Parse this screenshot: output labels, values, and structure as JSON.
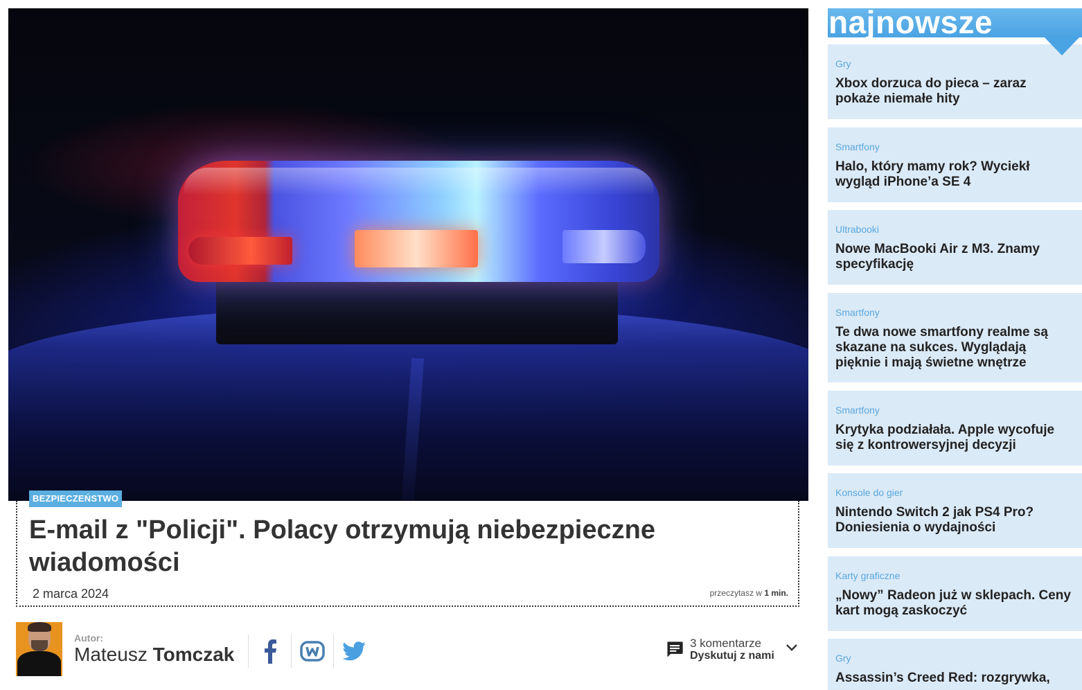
{
  "article": {
    "category": "BEZPIECZEŃSTWO",
    "title": "E-mail z \"Policji\". Polacy otrzymują niebezpieczne wiadomości",
    "date": "2 marca 2024",
    "read_time_prefix": "przeczytasz w",
    "read_time_value": "1 min.",
    "hero_image": "police-light-bar-photo"
  },
  "author": {
    "label": "Autor:",
    "first_name": "Mateusz",
    "last_name": "Tomczak"
  },
  "social": {
    "icons": [
      "facebook-icon",
      "wykop-icon",
      "twitter-icon"
    ]
  },
  "comments": {
    "count_text": "3 komentarze",
    "cta": "Dyskutuj z nami"
  },
  "sidebar": {
    "title": "najnowsze",
    "accent_color": "#4aa3e2",
    "card_color": "#dbeaf7",
    "items": [
      {
        "category": "Gry",
        "title": "Xbox dorzuca do pieca – zaraz pokaże niemałe hity"
      },
      {
        "category": "Smartfony",
        "title": "Halo, który mamy rok? Wyciekł wygląd iPhone’a SE 4"
      },
      {
        "category": "Ultrabooki",
        "title": "Nowe MacBooki Air z M3. Znamy specyfikację"
      },
      {
        "category": "Smartfony",
        "title": "Te dwa nowe smartfony realme są skazane na sukces. Wyglądają pięknie i mają świetne wnętrze"
      },
      {
        "category": "Smartfony",
        "title": "Krytyka podziałała. Apple wycofuje się z kontrowersyjnej decyzji"
      },
      {
        "category": "Konsole do gier",
        "title": "Nintendo Switch 2 jak PS4 Pro? Doniesienia o wydajności"
      },
      {
        "category": "Karty graficzne",
        "title": "„Nowy” Radeon już w sklepach. Ceny kart mogą zaskoczyć"
      },
      {
        "category": "Gry",
        "title": "Assassin’s Creed Red: rozgrywka,"
      }
    ]
  }
}
